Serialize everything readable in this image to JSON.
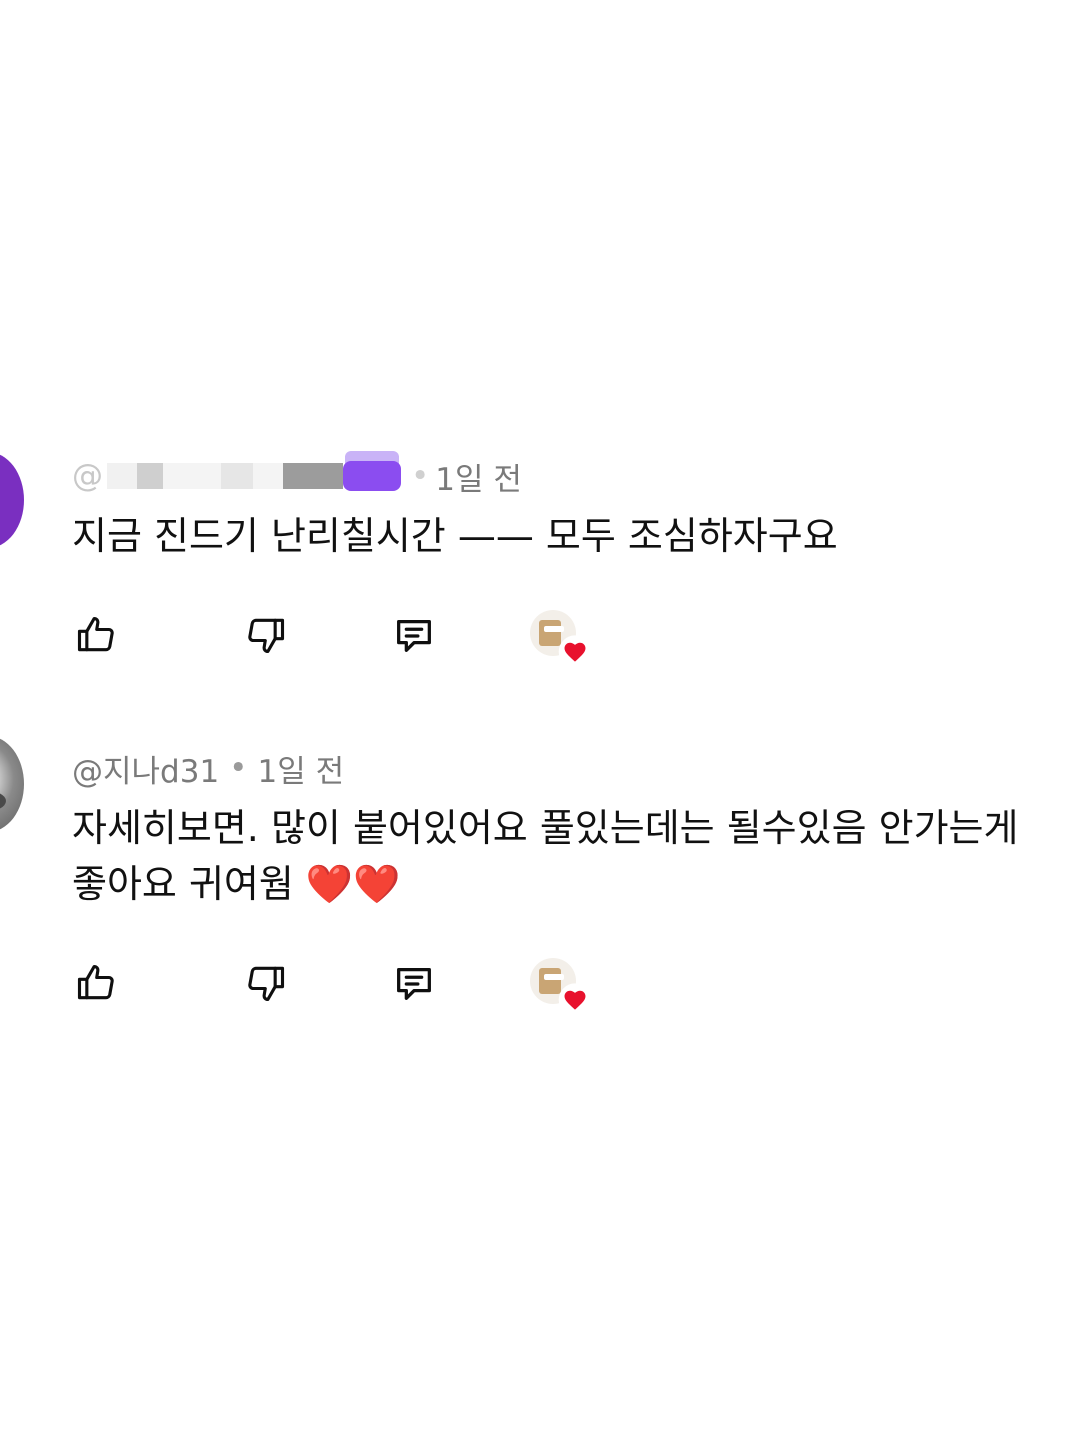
{
  "comments": [
    {
      "author": "@",
      "separator": "•",
      "time": "1일 전",
      "text": "지금 진드기 난리칠시간 —— 모두 조심하자구요",
      "avatar_color": "#7a2fc0"
    },
    {
      "author": "@지나d31",
      "separator": "•",
      "time": "1일 전",
      "text": "자세히보면. 많이 붙어있어요 풀있는데는 될수있음 안가는게 좋아요 귀여웜 ❤️❤️"
    }
  ],
  "icons": {
    "like": "thumbs-up-icon",
    "dislike": "thumbs-down-icon",
    "reply": "comment-icon",
    "creator_heart": "heart-icon"
  },
  "colors": {
    "heart": "#e8112d",
    "meta_text": "#7a7a7a"
  }
}
